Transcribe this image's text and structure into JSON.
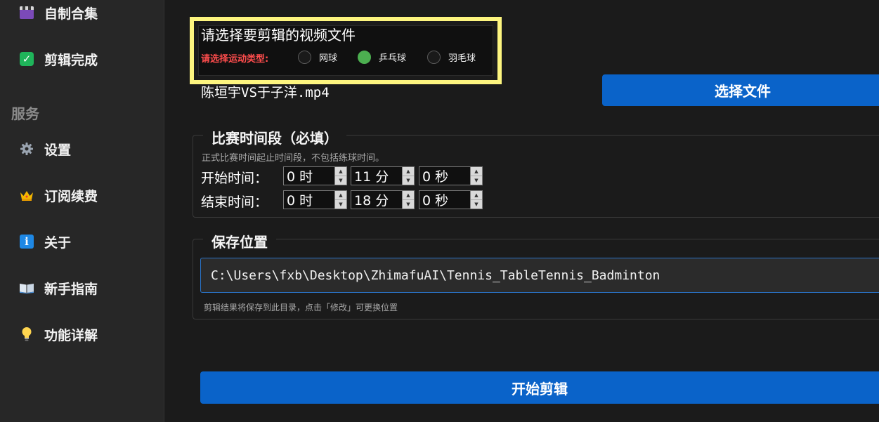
{
  "sidebar": {
    "items_top": [
      {
        "icon": "clapperboard-icon",
        "label": "自制合集"
      },
      {
        "icon": "check-box-icon",
        "label": "剪辑完成"
      }
    ],
    "section_title": "服务",
    "items_service": [
      {
        "icon": "gear-icon",
        "label": "设置"
      },
      {
        "icon": "crown-icon",
        "label": "订阅续费"
      },
      {
        "icon": "info-icon",
        "label": "关于"
      },
      {
        "icon": "book-icon",
        "label": "新手指南"
      },
      {
        "icon": "lightbulb-icon",
        "label": "功能详解"
      }
    ]
  },
  "file_select": {
    "title": "请选择要剪辑的视频文件",
    "sport_type_label": "请选择运动类型:",
    "sport_options": [
      {
        "label": "网球",
        "selected": false
      },
      {
        "label": "乒乓球",
        "selected": true
      },
      {
        "label": "羽毛球",
        "selected": false
      }
    ],
    "filename": "陈垣宇VS于子洋.mp4",
    "select_button": "选择文件"
  },
  "match_time": {
    "title": "比赛时间段（必填）",
    "hint": "正式比赛时间起止时间段，不包括练球时间。",
    "start_label": "开始时间：",
    "end_label": "结束时间：",
    "start": {
      "hour": "0 时",
      "minute": "11 分",
      "second": "0 秒"
    },
    "end": {
      "hour": "0 时",
      "minute": "18 分",
      "second": "0 秒"
    }
  },
  "save_location": {
    "title": "保存位置",
    "path": "C:\\Users\\fxb\\Desktop\\ZhimafuAI\\Tennis_TableTennis_Badminton",
    "hint": "剪辑结果将保存到此目录，点击「修改」可更换位置"
  },
  "start_button": "开始剪辑",
  "colors": {
    "accent_blue": "#0a63c9",
    "highlight_yellow": "#fdf57f",
    "radio_selected": "#4caf50",
    "warning_red": "#ff4d4d"
  }
}
